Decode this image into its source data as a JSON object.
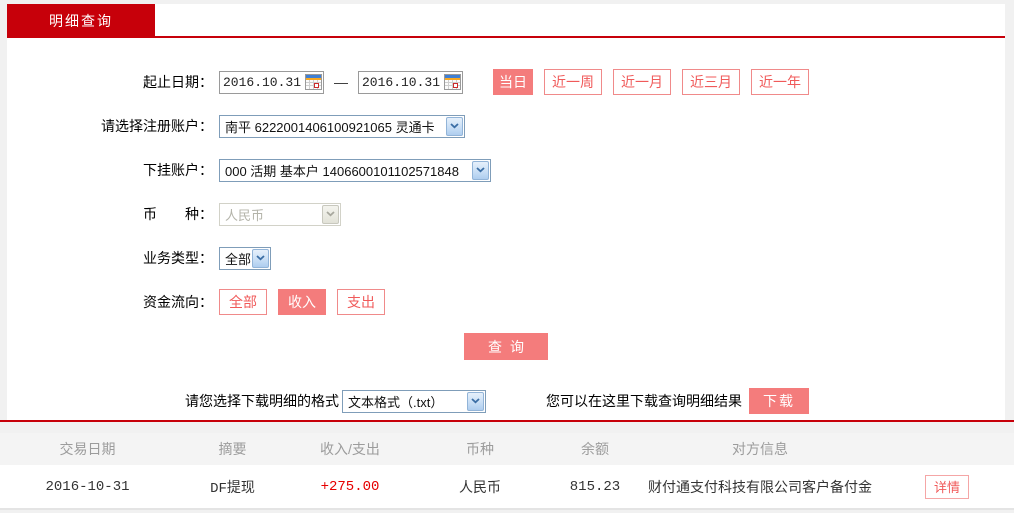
{
  "tab": {
    "label": "明细查询"
  },
  "form": {
    "date_range": {
      "label": "起止日期：",
      "start": "2016.10.31",
      "end": "2016.10.31",
      "separator": "—"
    },
    "quick_buttons": [
      {
        "label": "当日",
        "selected": true
      },
      {
        "label": "近一周",
        "selected": false
      },
      {
        "label": "近一月",
        "selected": false
      },
      {
        "label": "近三月",
        "selected": false
      },
      {
        "label": "近一年",
        "selected": false
      }
    ],
    "register_account": {
      "label": "请选择注册账户：",
      "value": "南平 6222001406100921065 灵通卡"
    },
    "sub_account": {
      "label": "下挂账户：",
      "value": "000 活期 基本户 1406600101102571848"
    },
    "currency": {
      "label": "币　　种：",
      "value": "人民币",
      "disabled": true
    },
    "business_type": {
      "label": "业务类型：",
      "value": "全部"
    },
    "fund_flow": {
      "label": "资金流向：",
      "options": [
        {
          "label": "全部",
          "selected": false
        },
        {
          "label": "收入",
          "selected": true
        },
        {
          "label": "支出",
          "selected": false
        }
      ]
    },
    "query_button": "查询"
  },
  "download": {
    "format_label": "请您选择下载明细的格式",
    "format_value": "文本格式（.txt）",
    "hint": "您可以在这里下载查询明细结果",
    "button_label": "下载"
  },
  "table": {
    "headers": [
      "交易日期",
      "摘要",
      "收入/支出",
      "币种",
      "余额",
      "对方信息",
      ""
    ],
    "rows": [
      {
        "date": "2016-10-31",
        "summary": "DF提现",
        "amount": "+275.00",
        "currency": "人民币",
        "balance": "815.23",
        "counterparty": "财付通支付科技有限公司客户备付金",
        "action_label": "详情"
      }
    ]
  },
  "colors": {
    "brand_red": "#c7000a",
    "button_pink": "#f47c7c",
    "amount_red": "#e60000",
    "page_bg": "#f1f1f1"
  }
}
